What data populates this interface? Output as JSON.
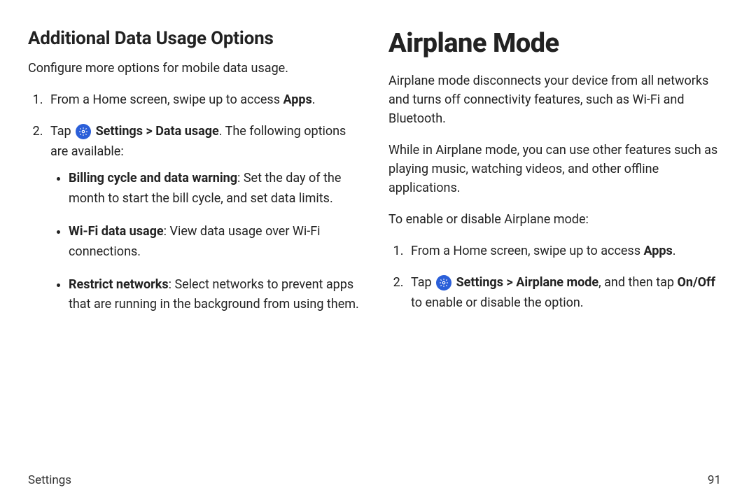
{
  "footer": {
    "section": "Settings",
    "page": "91"
  },
  "left": {
    "heading": "Additional Data Usage Options",
    "intro": "Configure more options for mobile data usage.",
    "step1_pre": "From a Home screen, swipe up to access ",
    "step1_bold": "Apps",
    "step1_post": ".",
    "step2_pre": "Tap ",
    "step2_settings": "Settings",
    "step2_chev": " > ",
    "step2_data": "Data usage",
    "step2_post": ". The following options are available:",
    "opt1_bold": "Billing cycle and data warning",
    "opt1_rest": ": Set the day of the month to start the bill cycle, and set data limits.",
    "opt2_bold": "Wi-Fi data usage",
    "opt2_rest": ": View data usage over Wi-Fi connections.",
    "opt3_bold": "Restrict networks",
    "opt3_rest": ": Select networks to prevent apps that are running in the background from using them."
  },
  "right": {
    "heading": "Airplane Mode",
    "p1": "Airplane mode disconnects your device from all networks and turns off connectivity features, such as Wi-Fi and Bluetooth.",
    "p2": "While in Airplane mode, you can use other features such as playing music, watching videos, and other offline applications.",
    "p3": "To enable or disable Airplane mode:",
    "step1_pre": "From a Home screen, swipe up to access ",
    "step1_bold": "Apps",
    "step1_post": ".",
    "step2_pre": "Tap ",
    "step2_settings": "Settings",
    "step2_chev": " > ",
    "step2_mode": "Airplane mode",
    "step2_mid": ", and then tap ",
    "step2_onoff": "On/Off",
    "step2_post": " to enable or disable the option."
  }
}
